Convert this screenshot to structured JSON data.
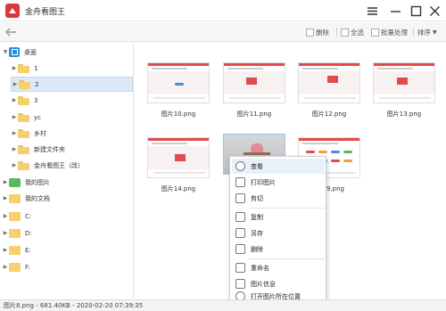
{
  "app": {
    "title": "金舟看图王"
  },
  "toolbar": {
    "delete_label": "删除",
    "select_all_label": "全选",
    "batch_label": "批量处理",
    "sort_label": "排序"
  },
  "sidebar": {
    "items": [
      {
        "label": "桌面"
      },
      {
        "label": "1"
      },
      {
        "label": "2"
      },
      {
        "label": "3"
      },
      {
        "label": "yc"
      },
      {
        "label": "乡村"
      },
      {
        "label": "新建文件夹"
      },
      {
        "label": "金舟看图王（改）"
      },
      {
        "label": "我的图片"
      },
      {
        "label": "我的文档"
      },
      {
        "label": "C:"
      },
      {
        "label": "D:"
      },
      {
        "label": "E:"
      },
      {
        "label": "F:"
      }
    ]
  },
  "files": [
    {
      "name": "图片10.png"
    },
    {
      "name": "图片11.png"
    },
    {
      "name": "图片12.png"
    },
    {
      "name": "图片13.png"
    },
    {
      "name": "图片14.png"
    },
    {
      "name": "图片9.png"
    }
  ],
  "context_menu": {
    "items": [
      {
        "label": "查看",
        "icon": "zoom-icon"
      },
      {
        "label": "打印图片",
        "icon": "printer-icon"
      },
      {
        "label": "剪切",
        "icon": "cut-icon"
      },
      {
        "label": "复制",
        "icon": "copy-icon"
      },
      {
        "label": "另存",
        "icon": "save-as-icon"
      },
      {
        "label": "删除",
        "icon": "trash-icon"
      },
      {
        "label": "重命名",
        "icon": "rename-icon"
      },
      {
        "label": "图片信息",
        "icon": "info-icon"
      },
      {
        "label": "打开图片所在位置",
        "icon": "location-icon"
      }
    ]
  },
  "status": {
    "text": "图片8.png - 681.40KB - 2020-02-20 07:39:35"
  },
  "colors": {
    "brand": "#d9393b",
    "selection": "#dbe9f8",
    "accent": "#4b8ad8"
  }
}
